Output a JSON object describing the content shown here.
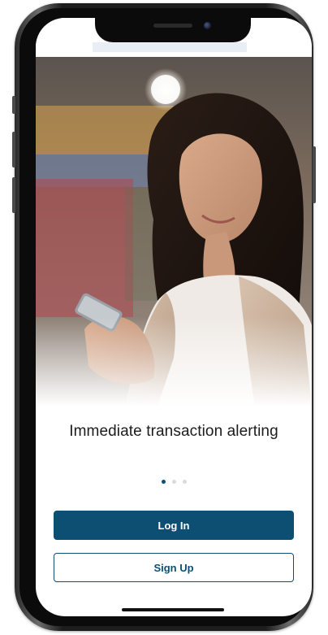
{
  "onboarding": {
    "headline": "Immediate transaction alerting",
    "carousel": {
      "page_count": 3,
      "active_index": 0
    },
    "login_label": "Log In",
    "signup_label": "Sign Up"
  },
  "hero_image": {
    "subject": "photo"
  },
  "colors": {
    "primary": "#0d4f73",
    "text": "#1c1c1c",
    "dot_inactive": "#d7dce2",
    "background": "#ffffff"
  }
}
